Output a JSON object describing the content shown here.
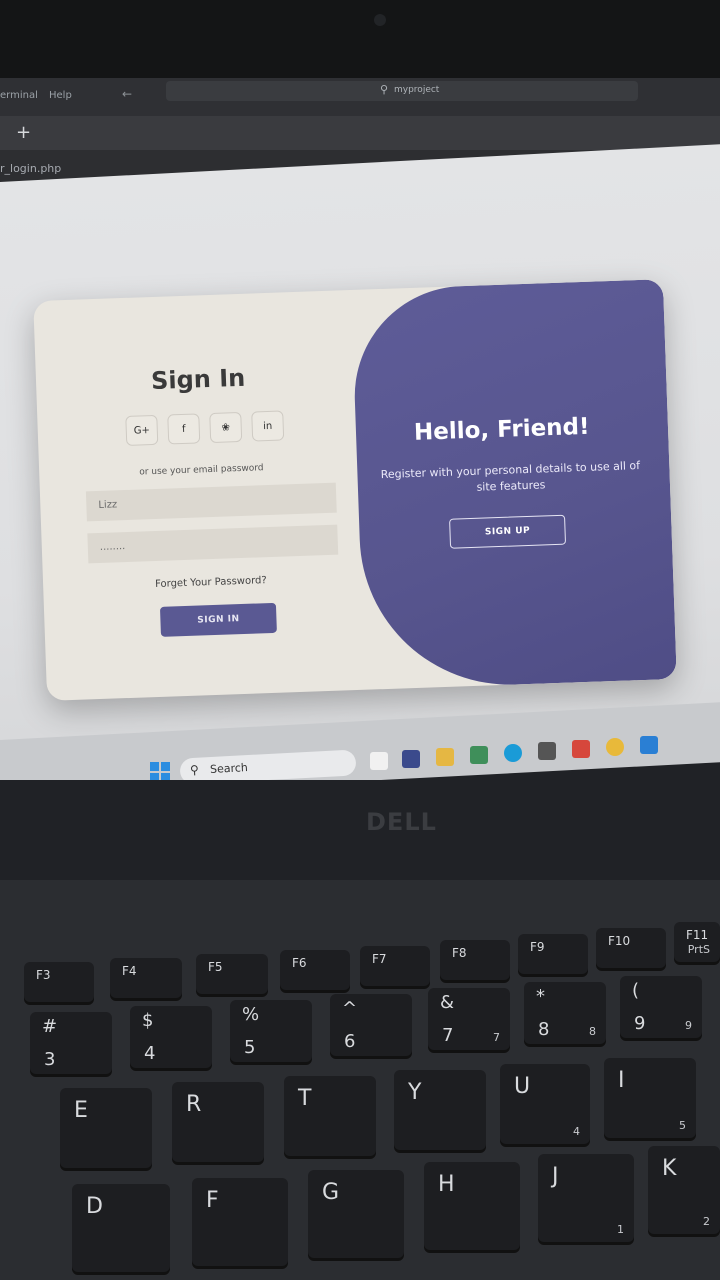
{
  "editor": {
    "menu_items": [
      "erminal",
      "Help"
    ],
    "back_arrow": "←",
    "command_center": "myproject",
    "new_tab": "+",
    "file_name": "r_login.php"
  },
  "login_form": {
    "title": "Sign In",
    "social": [
      "G+",
      "f",
      "❀",
      "in"
    ],
    "alt_text": "or use your email password",
    "email_value": "Lizz",
    "password_value": "........",
    "forgot": "Forget Your Password?",
    "signin_label": "SIGN IN"
  },
  "panel": {
    "heading": "Hello, Friend!",
    "text": "Register with your personal details to use all of site features",
    "signup_label": "SIGN UP"
  },
  "taskbar": {
    "search_label": "Search"
  },
  "laptop": {
    "brand": "DELL"
  },
  "keyboard": {
    "fn_keys": [
      "F3",
      "F4",
      "F5",
      "F6",
      "F7",
      "F8",
      "F9",
      "F10",
      "F11"
    ],
    "fn_extra": "PrtS",
    "num_keys": [
      {
        "top": "#",
        "bottom": "3"
      },
      {
        "top": "$",
        "bottom": "4"
      },
      {
        "top": "%",
        "bottom": "5"
      },
      {
        "top": "^",
        "bottom": "6"
      },
      {
        "top": "&",
        "bottom": "7",
        "num": "7"
      },
      {
        "top": "*",
        "bottom": "8",
        "num": "8"
      },
      {
        "top": "(",
        "bottom": "9",
        "num": "9"
      }
    ],
    "row_q": [
      {
        "label": "E"
      },
      {
        "label": "R"
      },
      {
        "label": "T"
      },
      {
        "label": "Y"
      },
      {
        "label": "U",
        "num": "4"
      },
      {
        "label": "I",
        "num": "5"
      }
    ],
    "row_a": [
      {
        "label": "D"
      },
      {
        "label": "F"
      },
      {
        "label": "G"
      },
      {
        "label": "H"
      },
      {
        "label": "J",
        "num": "1"
      },
      {
        "label": "K",
        "num": "2"
      }
    ]
  }
}
